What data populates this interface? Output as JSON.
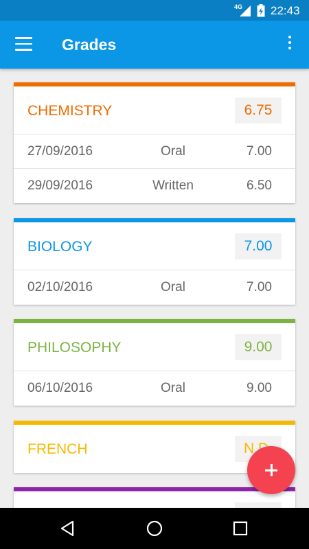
{
  "status_bar": {
    "network": "4G",
    "time": "22:43"
  },
  "app_bar": {
    "title": "Grades"
  },
  "subjects": [
    {
      "name": "CHEMISTRY",
      "average": "6.75",
      "color": "#ef6c00",
      "grades": [
        {
          "date": "27/09/2016",
          "type": "Oral",
          "grade": "7.00"
        },
        {
          "date": "29/09/2016",
          "type": "Written",
          "grade": "6.50"
        }
      ]
    },
    {
      "name": "BIOLOGY",
      "average": "7.00",
      "color": "#0b96e6",
      "grades": [
        {
          "date": "02/10/2016",
          "type": "Oral",
          "grade": "7.00"
        }
      ]
    },
    {
      "name": "PHILOSOPHY",
      "average": "9.00",
      "color": "#7cb342",
      "grades": [
        {
          "date": "06/10/2016",
          "type": "Oral",
          "grade": "9.00"
        }
      ]
    },
    {
      "name": "FRENCH",
      "average": "N.D.",
      "color": "#f7b900",
      "grades": []
    },
    {
      "name": "",
      "average": "",
      "color": "#8e24aa",
      "grades": []
    }
  ],
  "fab": {
    "icon": "plus-icon"
  },
  "nav_bar": {
    "icons": [
      "back-icon",
      "home-icon",
      "recents-icon"
    ]
  }
}
